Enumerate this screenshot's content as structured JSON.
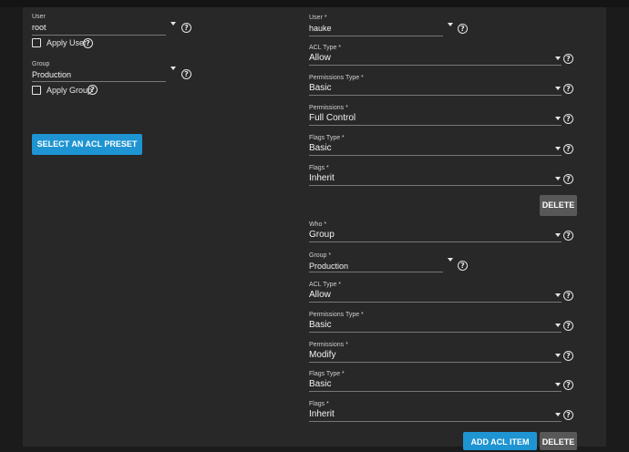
{
  "owner": {
    "user": {
      "label": "User",
      "value": "root",
      "apply_label": "Apply User"
    },
    "group": {
      "label": "Group",
      "value": "Production",
      "apply_label": "Apply Group"
    },
    "preset_button": "SELECT AN ACL PRESET"
  },
  "ace1": {
    "user": {
      "label": "User *",
      "value": "hauke"
    },
    "acl_type": {
      "label": "ACL Type *",
      "value": "Allow"
    },
    "perm_type": {
      "label": "Permissions Type *",
      "value": "Basic"
    },
    "permissions": {
      "label": "Permissions *",
      "value": "Full Control"
    },
    "flags_type": {
      "label": "Flags Type *",
      "value": "Basic"
    },
    "flags": {
      "label": "Flags *",
      "value": "Inherit"
    },
    "delete_label": "DELETE"
  },
  "ace2": {
    "who": {
      "label": "Who *",
      "value": "Group"
    },
    "group": {
      "label": "Group *",
      "value": "Production"
    },
    "acl_type": {
      "label": "ACL Type *",
      "value": "Allow"
    },
    "perm_type": {
      "label": "Permissions Type *",
      "value": "Basic"
    },
    "permissions": {
      "label": "Permissions *",
      "value": "Modify"
    },
    "flags_type": {
      "label": "Flags Type *",
      "value": "Basic"
    },
    "flags": {
      "label": "Flags *",
      "value": "Inherit"
    },
    "delete_label": "DELETE"
  },
  "add_acl_item_label": "ADD ACL ITEM",
  "icons": {
    "help": "help-circle-icon",
    "dropdown": "chevron-down-icon",
    "checkbox": "checkbox-empty"
  },
  "colors": {
    "primary": "#1e94d3",
    "delete": "#585858",
    "card": "#282828",
    "background": "#1b1b1b"
  }
}
